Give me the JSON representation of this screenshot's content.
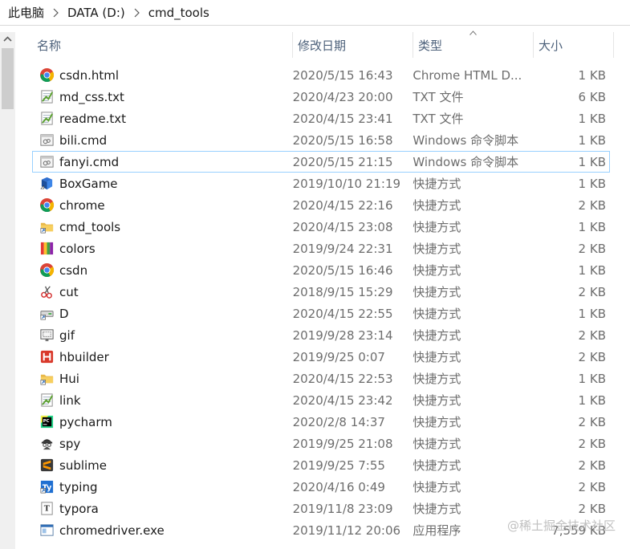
{
  "breadcrumb": {
    "items": [
      "此电脑",
      "DATA (D:)",
      "cmd_tools"
    ]
  },
  "header": {
    "name": "名称",
    "date": "修改日期",
    "type": "类型",
    "size": "大小",
    "sort_column": "type"
  },
  "files": [
    {
      "name": "csdn.html",
      "date": "2020/5/15 16:43",
      "type": "Chrome HTML D...",
      "size": "1 KB",
      "icon": "chrome-icon"
    },
    {
      "name": "md_css.txt",
      "date": "2020/4/23 20:00",
      "type": "TXT 文件",
      "size": "6 KB",
      "icon": "notepad-plus-icon"
    },
    {
      "name": "readme.txt",
      "date": "2020/4/15 23:41",
      "type": "TXT 文件",
      "size": "1 KB",
      "icon": "notepad-plus-icon"
    },
    {
      "name": "bili.cmd",
      "date": "2020/5/15 16:58",
      "type": "Windows 命令脚本",
      "size": "1 KB",
      "icon": "cmd-script-icon"
    },
    {
      "name": "fanyi.cmd",
      "date": "2020/5/15 21:15",
      "type": "Windows 命令脚本",
      "size": "1 KB",
      "icon": "cmd-script-icon"
    },
    {
      "name": "BoxGame",
      "date": "2019/10/10 21:19",
      "type": "快捷方式",
      "size": "1 KB",
      "icon": "boxgame-icon"
    },
    {
      "name": "chrome",
      "date": "2020/4/15 22:16",
      "type": "快捷方式",
      "size": "2 KB",
      "icon": "chrome-icon"
    },
    {
      "name": "cmd_tools",
      "date": "2020/4/15 23:08",
      "type": "快捷方式",
      "size": "1 KB",
      "icon": "folder-shortcut-icon"
    },
    {
      "name": "colors",
      "date": "2019/9/24 22:31",
      "type": "快捷方式",
      "size": "2 KB",
      "icon": "colors-icon"
    },
    {
      "name": "csdn",
      "date": "2020/5/15 16:46",
      "type": "快捷方式",
      "size": "1 KB",
      "icon": "chrome-icon"
    },
    {
      "name": "cut",
      "date": "2018/9/15 15:29",
      "type": "快捷方式",
      "size": "2 KB",
      "icon": "snipping-icon"
    },
    {
      "name": "D",
      "date": "2020/4/15 22:55",
      "type": "快捷方式",
      "size": "1 KB",
      "icon": "drive-shortcut-icon"
    },
    {
      "name": "gif",
      "date": "2019/9/28 23:14",
      "type": "快捷方式",
      "size": "2 KB",
      "icon": "gif-recorder-icon"
    },
    {
      "name": "hbuilder",
      "date": "2019/9/25 0:07",
      "type": "快捷方式",
      "size": "2 KB",
      "icon": "hbuilder-icon"
    },
    {
      "name": "Hui",
      "date": "2020/4/15 22:53",
      "type": "快捷方式",
      "size": "1 KB",
      "icon": "folder-shortcut-icon"
    },
    {
      "name": "link",
      "date": "2020/4/15 23:42",
      "type": "快捷方式",
      "size": "1 KB",
      "icon": "notepad-plus-icon"
    },
    {
      "name": "pycharm",
      "date": "2020/2/8 14:37",
      "type": "快捷方式",
      "size": "2 KB",
      "icon": "pycharm-icon"
    },
    {
      "name": "spy",
      "date": "2019/9/25 21:08",
      "type": "快捷方式",
      "size": "2 KB",
      "icon": "spy-icon"
    },
    {
      "name": "sublime",
      "date": "2019/9/25 7:55",
      "type": "快捷方式",
      "size": "2 KB",
      "icon": "sublime-icon"
    },
    {
      "name": "typing",
      "date": "2020/4/16 0:49",
      "type": "快捷方式",
      "size": "2 KB",
      "icon": "typing-icon"
    },
    {
      "name": "typora",
      "date": "2019/11/8 23:09",
      "type": "快捷方式",
      "size": "2 KB",
      "icon": "typora-icon"
    },
    {
      "name": "chromedriver.exe",
      "date": "2019/11/12 20:06",
      "type": "应用程序",
      "size": "7,559 KB",
      "icon": "exe-app-icon"
    }
  ],
  "focused_row": 4,
  "watermark": "@稀土掘金技术社区",
  "colors": {
    "header_text": "#4c607a",
    "focus_border": "#99d1ff",
    "secondary_text": "#6d6d6d"
  }
}
